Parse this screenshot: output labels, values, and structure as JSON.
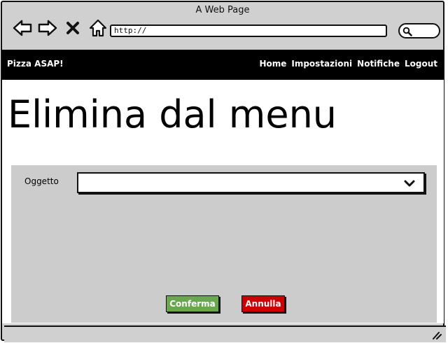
{
  "window": {
    "title": "A Web Page"
  },
  "browser": {
    "url": "http://",
    "icons": [
      "back-arrow-icon",
      "forward-arrow-icon",
      "close-x-icon",
      "home-icon",
      "search-icon"
    ]
  },
  "navbar": {
    "brand": "Pizza ASAP!",
    "links": [
      "Home",
      "Impostazioni",
      "Notifiche",
      "Logout"
    ]
  },
  "page": {
    "heading": "Elimina dal menu",
    "form": {
      "field_label": "Oggetto",
      "select_value": "",
      "confirm_label": "Conferma",
      "cancel_label": "Annulla"
    }
  },
  "colors": {
    "navbar_bg": "#000000",
    "confirm_green": "#6aa84f",
    "cancel_red": "#cc0000",
    "panel_gray": "#cccccc"
  }
}
